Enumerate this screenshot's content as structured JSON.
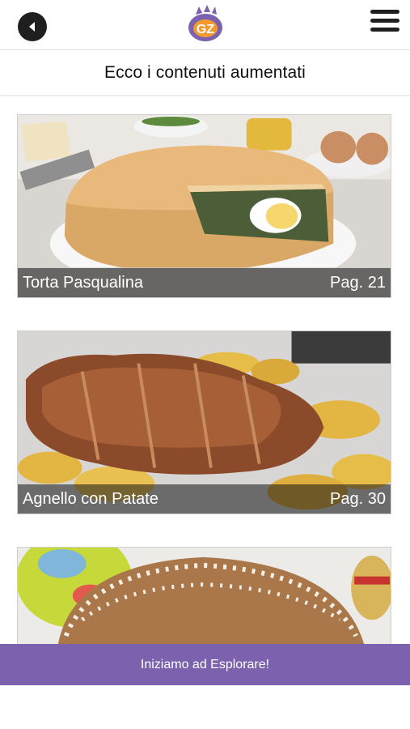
{
  "header": {
    "back_icon": "back-arrow-icon",
    "logo_text": "GZ",
    "menu_icon": "hamburger-menu-icon"
  },
  "subtitle": "Ecco i contenuti aumentati",
  "cards": [
    {
      "title": "Torta Pasqualina",
      "page": "Pag. 21"
    },
    {
      "title": "Agnello con Patate",
      "page": "Pag. 30"
    },
    {
      "title": "",
      "page": ""
    }
  ],
  "cta_label": "Iniziamo ad Esplorare!",
  "colors": {
    "accent": "#7b61ae",
    "logo_orange": "#f29a2e",
    "dark_icon": "#1f1f1f"
  }
}
